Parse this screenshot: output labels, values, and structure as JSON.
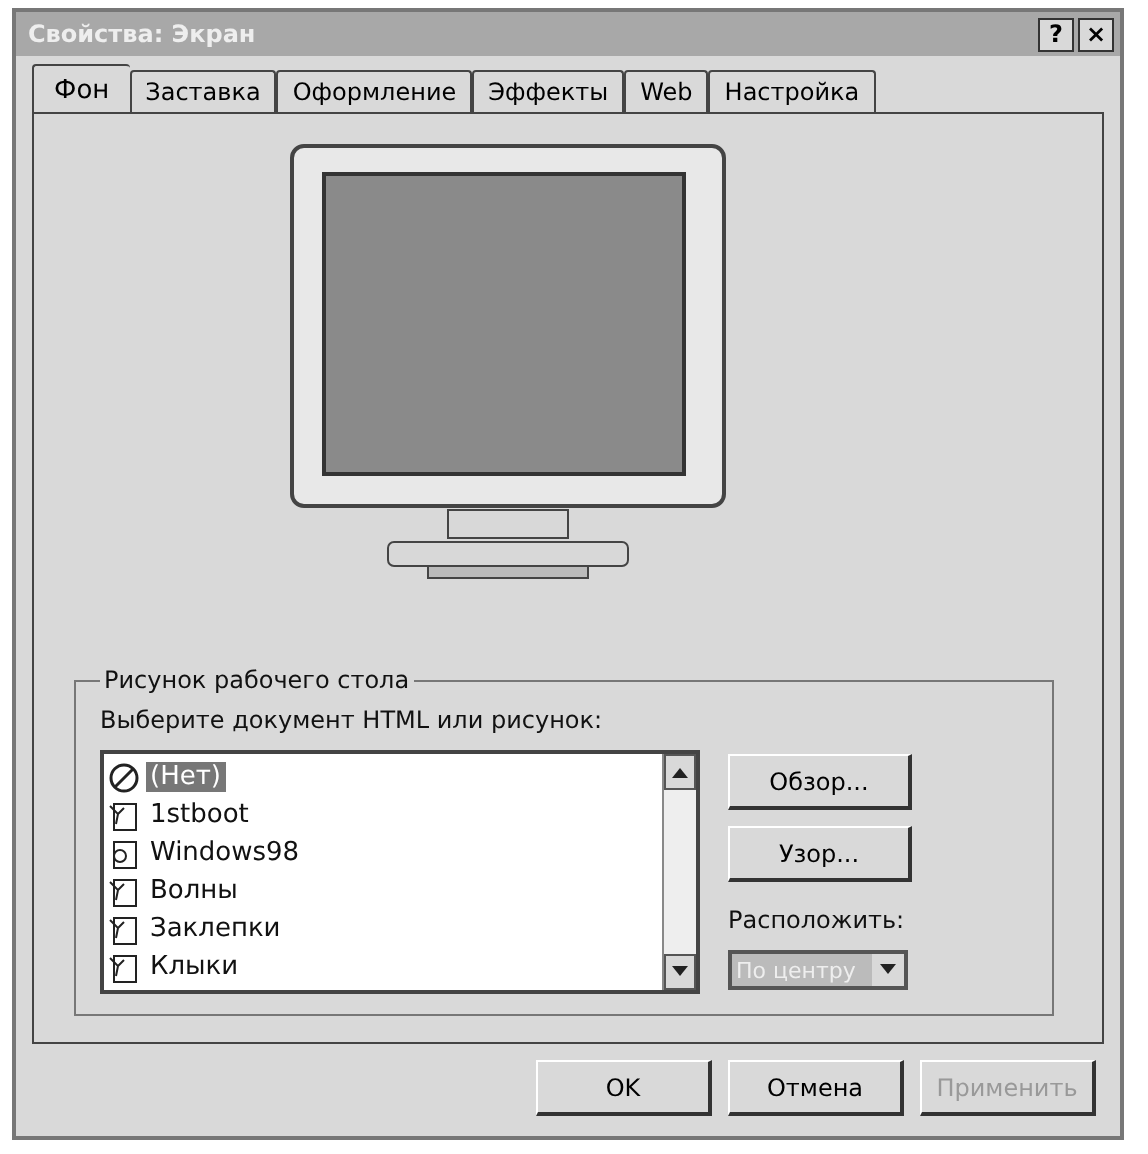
{
  "window": {
    "title": "Свойства: Экран",
    "buttons": [
      "?",
      "×"
    ]
  },
  "tabs": [
    {
      "label": "Фон",
      "selected": true
    },
    {
      "label": "Заставка",
      "selected": false
    },
    {
      "label": "Оформление",
      "selected": false
    },
    {
      "label": "Эффекты",
      "selected": false
    },
    {
      "label": "Web",
      "selected": false
    },
    {
      "label": "Настройка",
      "selected": false
    }
  ],
  "wallpaper_group": {
    "title": "Рисунок рабочего стола",
    "list_label": "Выберите документ HTML или рисунок:",
    "items": [
      {
        "label": "(Нет)",
        "kind": "none",
        "selected": true
      },
      {
        "label": "1stboot",
        "kind": "image",
        "selected": false
      },
      {
        "label": "Windows98",
        "kind": "html",
        "selected": false
      },
      {
        "label": "Волны",
        "kind": "image",
        "selected": false
      },
      {
        "label": "Заклепки",
        "kind": "image",
        "selected": false
      },
      {
        "label": "Клыки",
        "kind": "image",
        "selected": false
      }
    ],
    "browse_button": "Обзор...",
    "pattern_button": "Узор...",
    "position_label": "Расположить:",
    "position_value": "По центру"
  },
  "footer_buttons": [
    {
      "label": "OK",
      "disabled": false
    },
    {
      "label": "Отмена",
      "disabled": false
    },
    {
      "label": "Применить",
      "disabled": true
    }
  ]
}
